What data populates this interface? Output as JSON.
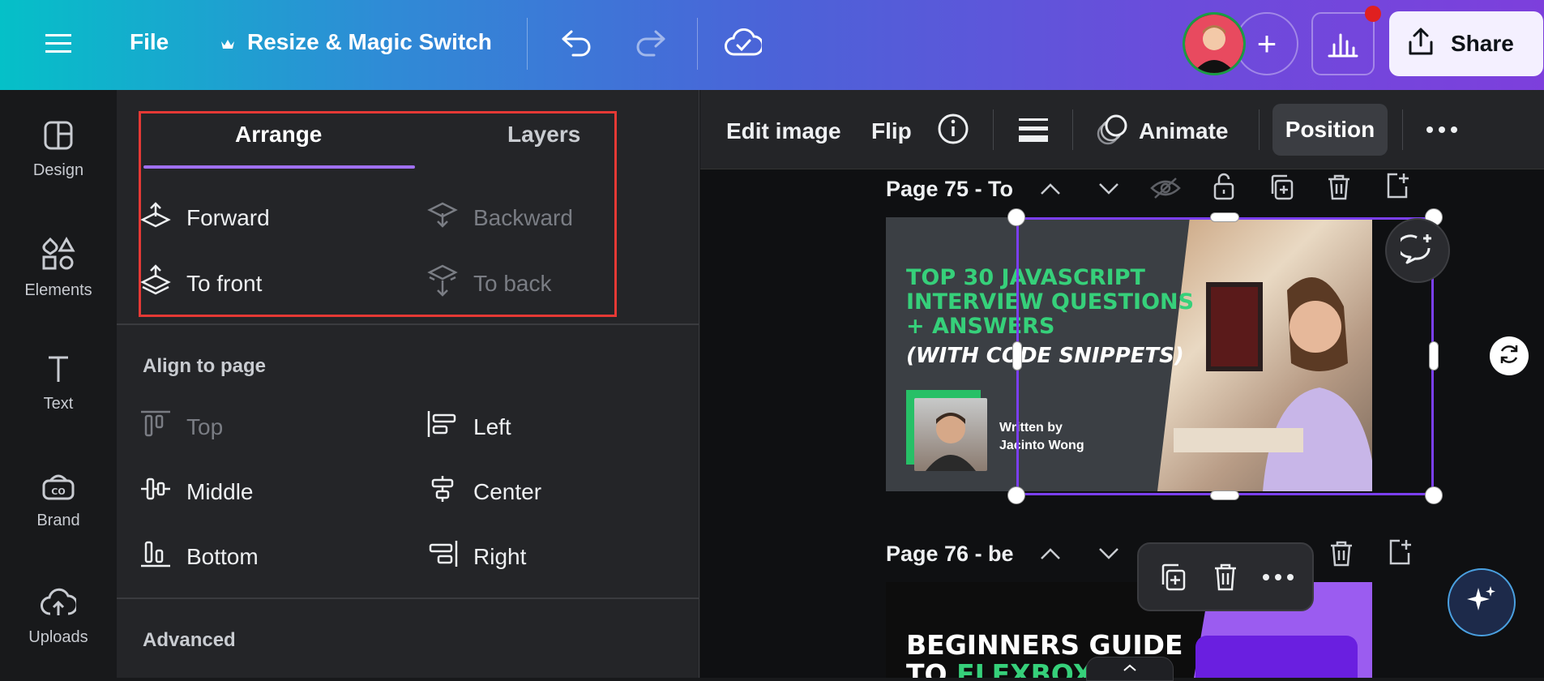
{
  "topbar": {
    "file_label": "File",
    "resize_label": "Resize & Magic Switch",
    "share_label": "Share"
  },
  "rail": {
    "items": [
      {
        "label": "Design",
        "icon": "design-icon"
      },
      {
        "label": "Elements",
        "icon": "elements-icon"
      },
      {
        "label": "Text",
        "icon": "text-icon"
      },
      {
        "label": "Brand",
        "icon": "brand-icon"
      },
      {
        "label": "Uploads",
        "icon": "uploads-icon"
      }
    ]
  },
  "panel": {
    "tabs": [
      {
        "label": "Arrange",
        "active": true
      },
      {
        "label": "Layers",
        "active": false
      }
    ],
    "arrange": {
      "forward": "Forward",
      "backward": "Backward",
      "to_front": "To front",
      "to_back": "To back"
    },
    "align_title": "Align to page",
    "align": {
      "top": "Top",
      "left": "Left",
      "middle": "Middle",
      "center": "Center",
      "bottom": "Bottom",
      "right": "Right"
    },
    "advanced_title": "Advanced"
  },
  "context_bar": {
    "edit_image": "Edit image",
    "flip": "Flip",
    "animate": "Animate",
    "position": "Position"
  },
  "pages": [
    {
      "title": "Page 75 - To"
    },
    {
      "title": "Page 76 - be"
    }
  ],
  "card1": {
    "title_lines": [
      "TOP 30 JAVASCRIPT",
      "INTERVIEW QUESTIONS",
      "+ ANSWERS"
    ],
    "subtitle": "(WITH CODE SNIPPETS)",
    "author_line1": "Written by",
    "author_line2": "Jacinto Wong"
  },
  "card2": {
    "line1": "BEGINNERS GUIDE",
    "line2_prefix": "TO ",
    "line2_accent": "FLEXBOX"
  },
  "colors": {
    "accent_purple": "#7b3ff2",
    "selection_red": "#e53935",
    "card_green": "#36d07a"
  }
}
